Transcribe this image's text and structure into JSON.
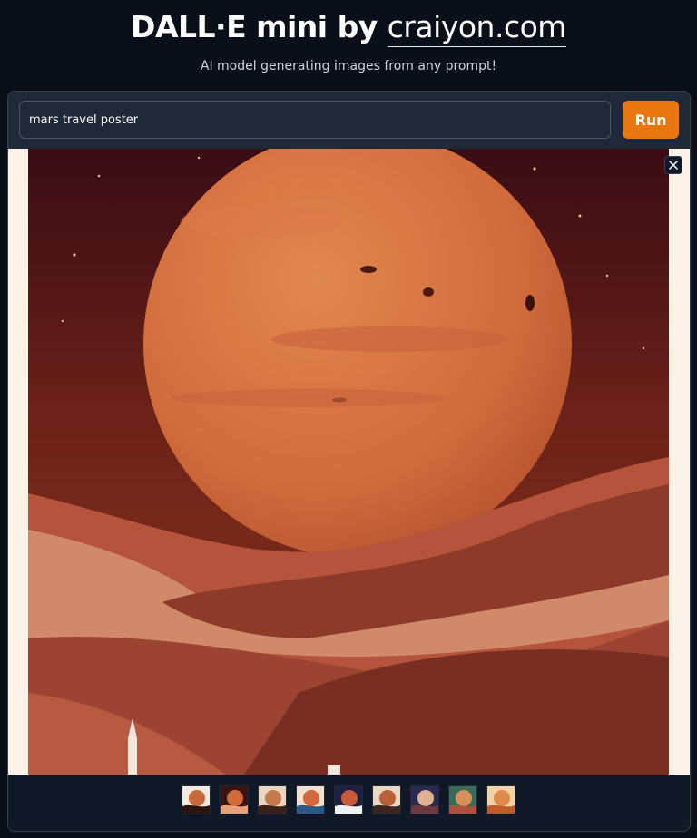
{
  "header": {
    "title_prefix": "DALL·E mini by ",
    "title_link": "craiyon.com",
    "subtitle": "AI model generating images from any prompt!"
  },
  "prompt": {
    "value": "mars travel poster"
  },
  "run_button": {
    "label": "Run"
  },
  "viewer": {
    "close_icon": "close-icon"
  },
  "gallery": {
    "thumbnails": [
      {
        "name": "thumbnail-1"
      },
      {
        "name": "thumbnail-2"
      },
      {
        "name": "thumbnail-3"
      },
      {
        "name": "thumbnail-4"
      },
      {
        "name": "thumbnail-5"
      },
      {
        "name": "thumbnail-6"
      },
      {
        "name": "thumbnail-7"
      },
      {
        "name": "thumbnail-8"
      },
      {
        "name": "thumbnail-9"
      }
    ]
  },
  "colors": {
    "background": "#0b0f19",
    "panel": "#1f2937",
    "accent": "#e8770e",
    "planet": "#d2693a",
    "sky": "#5a1a15"
  }
}
